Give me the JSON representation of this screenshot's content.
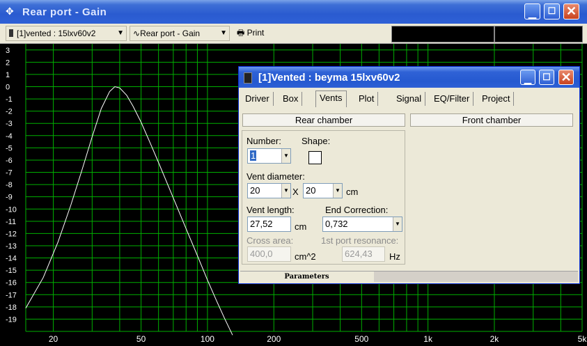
{
  "window": {
    "title": "Rear port - Gain"
  },
  "toolbar": {
    "driver_combo": "[1]vented : 15lxv60v2",
    "graph_combo": "Rear port - Gain",
    "print_label": "Print"
  },
  "plot": {
    "y_ticks": [
      "3",
      "2",
      "1",
      "0",
      "-1",
      "-2",
      "-3",
      "-4",
      "-5",
      "-6",
      "-7",
      "-8",
      "-9",
      "-10",
      "-11",
      "-12",
      "-13",
      "-14",
      "-15",
      "-16",
      "-17",
      "-18",
      "-19"
    ],
    "x_ticks": [
      {
        "label": "20",
        "value": 20
      },
      {
        "label": "50",
        "value": 50
      },
      {
        "label": "100",
        "value": 100
      },
      {
        "label": "200",
        "value": 200
      },
      {
        "label": "500",
        "value": 500
      },
      {
        "label": "1k",
        "value": 1000
      },
      {
        "label": "2k",
        "value": 2000
      },
      {
        "label": "5k",
        "value": 5000
      }
    ],
    "grid_color": "#00b000",
    "curve_color": "#ffffff"
  },
  "chart_data": {
    "type": "line",
    "x_scale": "log",
    "xlim": [
      15,
      5000
    ],
    "ylim": [
      -20,
      3.5
    ],
    "grid": true,
    "series": [
      {
        "x": [
          15,
          18,
          21,
          24,
          27,
          30,
          33,
          36,
          38,
          40,
          43,
          46,
          50,
          55,
          60,
          70,
          80,
          90,
          100,
          110,
          120,
          130
        ],
        "y": [
          -18.1,
          -15.6,
          -12.7,
          -9.7,
          -6.8,
          -4.1,
          -1.8,
          -0.4,
          0.0,
          -0.1,
          -0.7,
          -1.6,
          -2.9,
          -4.6,
          -6.2,
          -9.1,
          -11.6,
          -13.8,
          -15.8,
          -17.5,
          -19.0,
          -20.3
        ]
      }
    ]
  },
  "dialog": {
    "title": "[1]Vented : beyma 15lxv60v2",
    "tabs": [
      "Driver",
      "Box",
      "Vents",
      "Plot",
      "Signal",
      "EQ/Filter",
      "Project"
    ],
    "active_tab": "Vents",
    "rear_chamber_label": "Rear chamber",
    "front_chamber_label": "Front chamber",
    "number_label": "Number:",
    "number_value": "1",
    "shape_label": "Shape:",
    "vent_diameter_label": "Vent diameter:",
    "diameter_1": "20",
    "diameter_x": "X",
    "diameter_2": "20",
    "diameter_unit": "cm",
    "vent_length_label": "Vent length:",
    "vent_length_value": "27,52",
    "vent_length_unit": "cm",
    "end_correction_label": "End Correction:",
    "end_correction_value": "0,732",
    "cross_area_label": "Cross area:",
    "cross_area_value": "400,0",
    "cross_area_unit": "cm^2",
    "port_resonance_label": "1st port resonance:",
    "port_resonance_value": "624,43",
    "port_resonance_unit": "Hz",
    "status_label": "Parameters"
  }
}
